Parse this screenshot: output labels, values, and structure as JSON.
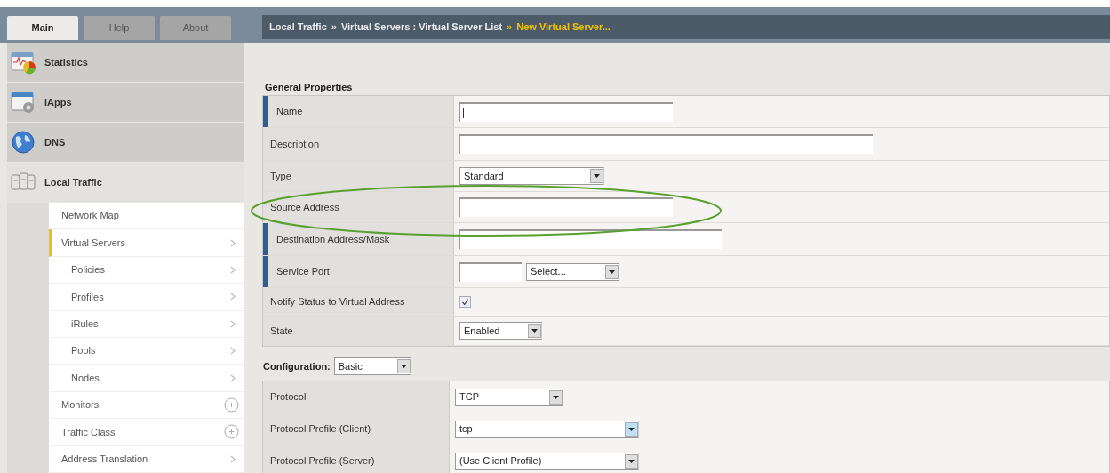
{
  "tabs": [
    {
      "label": "Main",
      "selected": true
    },
    {
      "label": "Help",
      "selected": false
    },
    {
      "label": "About",
      "selected": false
    }
  ],
  "breadcrumb": [
    {
      "text": "Local Traffic",
      "kind": "link"
    },
    {
      "text": "»",
      "kind": "sep"
    },
    {
      "text": "Virtual Servers : Virtual Server List",
      "kind": "link"
    },
    {
      "text": "»",
      "kind": "current"
    },
    {
      "text": "New Virtual Server...",
      "kind": "current"
    }
  ],
  "sidebar": {
    "sections": [
      {
        "label": "Statistics",
        "expanded": false
      },
      {
        "label": "iApps",
        "expanded": false
      },
      {
        "label": "DNS",
        "expanded": false
      },
      {
        "label": "Local Traffic",
        "expanded": true,
        "items": [
          {
            "label": "Network Map",
            "kind": "plain",
            "selected": false
          },
          {
            "label": "Virtual Servers",
            "kind": "submenu",
            "selected": true,
            "children": [
              {
                "label": "Policies",
                "kind": "submenu",
                "selected": false
              },
              {
                "label": "Profiles",
                "kind": "submenu",
                "selected": false
              },
              {
                "label": "iRules",
                "kind": "submenu",
                "selected": false
              },
              {
                "label": "Pools",
                "kind": "submenu",
                "selected": false
              },
              {
                "label": "Nodes",
                "kind": "submenu",
                "selected": false
              }
            ]
          },
          {
            "label": "Monitors",
            "kind": "add",
            "selected": false
          },
          {
            "label": "Traffic Class",
            "kind": "add",
            "selected": false
          },
          {
            "label": "Address Translation",
            "kind": "submenu",
            "selected": false
          }
        ]
      }
    ]
  },
  "general_properties": {
    "title": "General Properties",
    "rows": [
      {
        "label": "Name",
        "kind": "text",
        "required": true,
        "focused": true
      },
      {
        "label": "Description",
        "kind": "text",
        "required": false
      },
      {
        "label": "Type",
        "kind": "select",
        "required": false,
        "value": "Standard"
      },
      {
        "label": "Source Address",
        "kind": "text",
        "required": false
      },
      {
        "label": "Destination Address/Mask",
        "kind": "text",
        "required": true
      },
      {
        "label": "Service Port",
        "kind": "port",
        "required": true,
        "value": "Select..."
      },
      {
        "label": "Notify Status to Virtual Address",
        "kind": "checkbox",
        "required": false,
        "checked": true
      },
      {
        "label": "State",
        "kind": "select",
        "required": false,
        "value": "Enabled"
      }
    ]
  },
  "configuration": {
    "title": "Configuration:",
    "mode": "Basic",
    "rows": [
      {
        "label": "Protocol",
        "value": "TCP",
        "focused": false
      },
      {
        "label": "Protocol Profile (Client)",
        "value": "tcp",
        "focused": true
      },
      {
        "label": "Protocol Profile (Server)",
        "value": "(Use Client Profile)",
        "focused": false
      }
    ]
  },
  "annotation": {
    "kind": "ellipse"
  }
}
